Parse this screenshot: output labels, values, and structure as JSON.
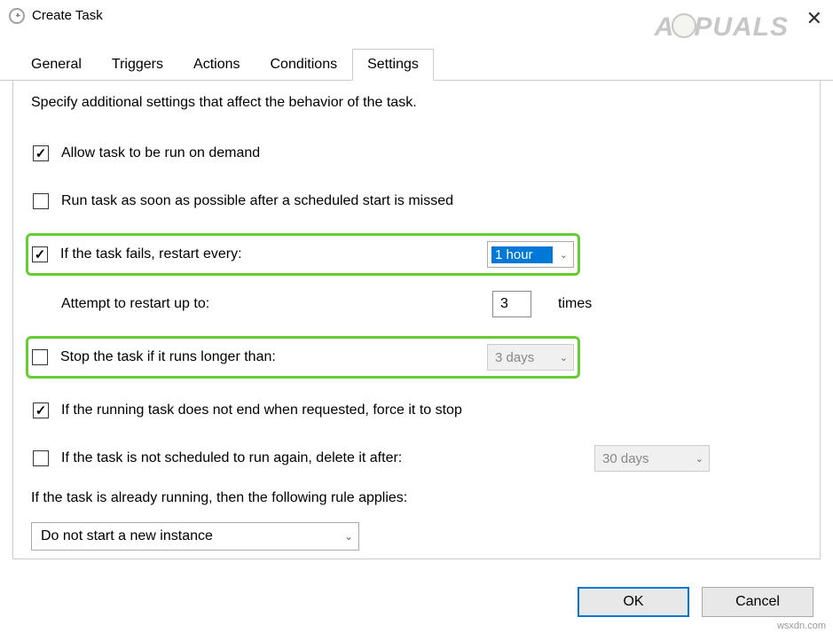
{
  "window": {
    "title": "Create Task"
  },
  "watermark": "APPUALS",
  "tabs": {
    "items": [
      "General",
      "Triggers",
      "Actions",
      "Conditions",
      "Settings"
    ],
    "active": 4
  },
  "settings": {
    "intro": "Specify additional settings that affect the behavior of the task.",
    "allow_on_demand": {
      "label": "Allow task to be run on demand",
      "checked": true
    },
    "run_asap": {
      "label": "Run task as soon as possible after a scheduled start is missed",
      "checked": false
    },
    "restart": {
      "label": "If the task fails, restart every:",
      "checked": true,
      "interval": "1 hour"
    },
    "attempt": {
      "label": "Attempt to restart up to:",
      "value": "3",
      "suffix": "times"
    },
    "stop_longer": {
      "label": "Stop the task if it runs longer than:",
      "checked": false,
      "value": "3 days"
    },
    "force_stop": {
      "label": "If the running task does not end when requested, force it to stop",
      "checked": true
    },
    "delete_after": {
      "label": "If the task is not scheduled to run again, delete it after:",
      "checked": false,
      "value": "30 days"
    },
    "rule_text": "If the task is already running, then the following rule applies:",
    "rule_value": "Do not start a new instance"
  },
  "buttons": {
    "ok": "OK",
    "cancel": "Cancel"
  },
  "site": "wsxdn.com"
}
